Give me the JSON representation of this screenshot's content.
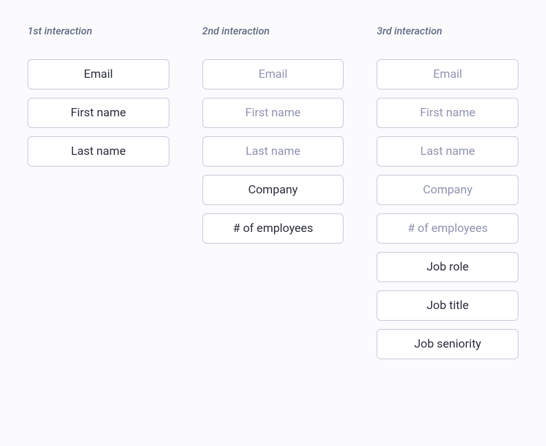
{
  "columns": [
    {
      "header": "1st interaction",
      "fields": [
        {
          "label": "Email",
          "state": "new"
        },
        {
          "label": "First name",
          "state": "new"
        },
        {
          "label": "Last name",
          "state": "new"
        }
      ]
    },
    {
      "header": "2nd interaction",
      "fields": [
        {
          "label": "Email",
          "state": "old"
        },
        {
          "label": "First name",
          "state": "old"
        },
        {
          "label": "Last name",
          "state": "old"
        },
        {
          "label": "Company",
          "state": "new"
        },
        {
          "label": "# of employees",
          "state": "new"
        }
      ]
    },
    {
      "header": "3rd interaction",
      "fields": [
        {
          "label": "Email",
          "state": "old"
        },
        {
          "label": "First name",
          "state": "old"
        },
        {
          "label": "Last name",
          "state": "old"
        },
        {
          "label": "Company",
          "state": "old"
        },
        {
          "label": "# of employees",
          "state": "old"
        },
        {
          "label": "Job role",
          "state": "new"
        },
        {
          "label": "Job title",
          "state": "new"
        },
        {
          "label": "Job seniority",
          "state": "new"
        }
      ]
    }
  ]
}
